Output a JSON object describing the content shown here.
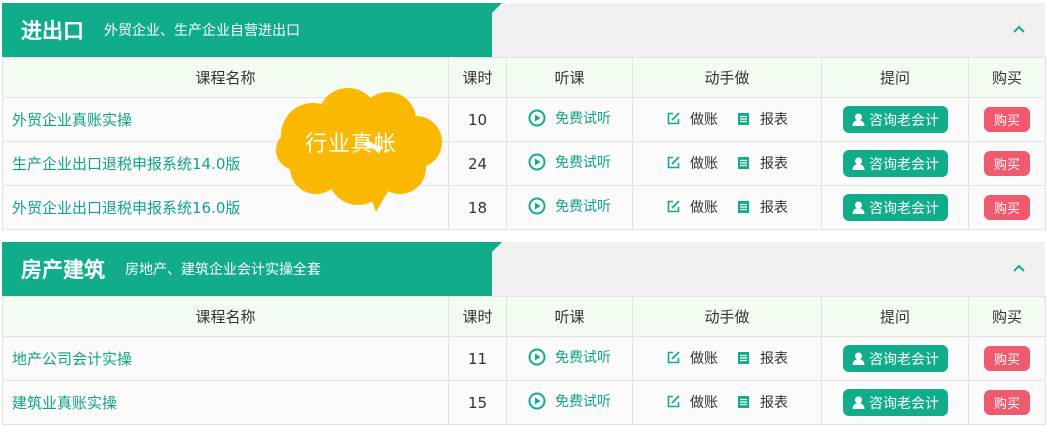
{
  "sections": [
    {
      "title": "进出口",
      "subtitle": "外贸企业、生产企业自营进出口",
      "headers": [
        "课程名称",
        "课时",
        "听课",
        "动手做",
        "提问",
        "购买"
      ],
      "rows": [
        {
          "name": "外贸企业真账实操",
          "hours": "10",
          "listen": "免费试听",
          "do1": "做账",
          "do2": "报表",
          "ask": "咨询老会计",
          "buy": "购买"
        },
        {
          "name": "生产企业出口退税申报系统14.0版",
          "hours": "24",
          "listen": "免费试听",
          "do1": "做账",
          "do2": "报表",
          "ask": "咨询老会计",
          "buy": "购买"
        },
        {
          "name": "外贸企业出口退税申报系统16.0版",
          "hours": "18",
          "listen": "免费试听",
          "do1": "做账",
          "do2": "报表",
          "ask": "咨询老会计",
          "buy": "购买"
        }
      ]
    },
    {
      "title": "房产建筑",
      "subtitle": "房地产、建筑企业会计实操全套",
      "headers": [
        "课程名称",
        "课时",
        "听课",
        "动手做",
        "提问",
        "购买"
      ],
      "rows": [
        {
          "name": "地产公司会计实操",
          "hours": "11",
          "listen": "免费试听",
          "do1": "做账",
          "do2": "报表",
          "ask": "咨询老会计",
          "buy": "购买"
        },
        {
          "name": "建筑业真账实操",
          "hours": "15",
          "listen": "免费试听",
          "do1": "做账",
          "do2": "报表",
          "ask": "咨询老会计",
          "buy": "购买"
        }
      ]
    }
  ],
  "badge": {
    "text": "行业真帐"
  },
  "icons": {
    "collapse": "chevron-up-icon",
    "listen": "play-circle-icon",
    "bookkeeping": "edit-icon",
    "report": "report-icon",
    "ask": "user-icon"
  },
  "colors": {
    "accent": "#11ad8a",
    "buy": "#ee5a6e",
    "badge": "#fbb800"
  }
}
